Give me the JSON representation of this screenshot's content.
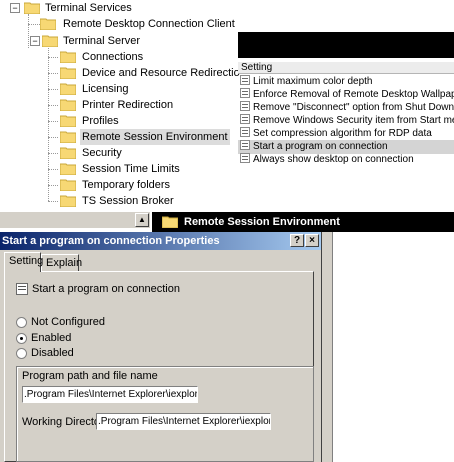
{
  "tree": {
    "terminal_services": "Terminal Services",
    "rdc_client": "Remote Desktop Connection Client",
    "terminal_server": "Terminal Server",
    "children": [
      "Connections",
      "Device and Resource Redirectio",
      "Licensing",
      "Printer Redirection",
      "Profiles",
      "Remote Session Environment",
      "Security",
      "Session Time Limits",
      "Temporary folders",
      "TS Session Broker"
    ],
    "expander_collapse": "−"
  },
  "settings_list": {
    "header": "Setting",
    "items": [
      "Limit maximum color depth",
      "Enforce Removal of Remote Desktop Wallpaper",
      "Remove \"Disconnect\" option from Shut Down dialog",
      "Remove Windows Security item from Start menu",
      "Set compression algorithm for RDP data",
      "Start a program on connection",
      "Always show desktop on connection"
    ]
  },
  "node_title": "Remote Session Environment",
  "scroll_arrow": "▲",
  "dialog": {
    "title": "Start a program on connection Properties",
    "help_button": "?",
    "close_button": "×",
    "tabs": {
      "setting": "Setting",
      "explain": "Explain"
    },
    "policy_name": "Start a program on connection",
    "radios": {
      "not_configured": "Not Configured",
      "enabled": "Enabled",
      "disabled": "Disabled",
      "selected": "enabled"
    },
    "program_label": "Program path and file name",
    "program_value": ".Program Files\\Internet Explorer\\iexplore.exe\"",
    "working_dir_label": "Working Directory",
    "working_dir_value": ".Program Files\\Internet Explorer\\iexplore.exe\"|"
  },
  "colors": {
    "title_gradient_start": "#0a246a",
    "title_gradient_end": "#a6caf0",
    "dialog_face": "#d4d0c8",
    "folder_yellow": "#f7d874"
  },
  "icons": [
    "folder-icon",
    "policy-setting-icon",
    "help-icon",
    "close-icon",
    "scroll-up-arrow-icon"
  ]
}
